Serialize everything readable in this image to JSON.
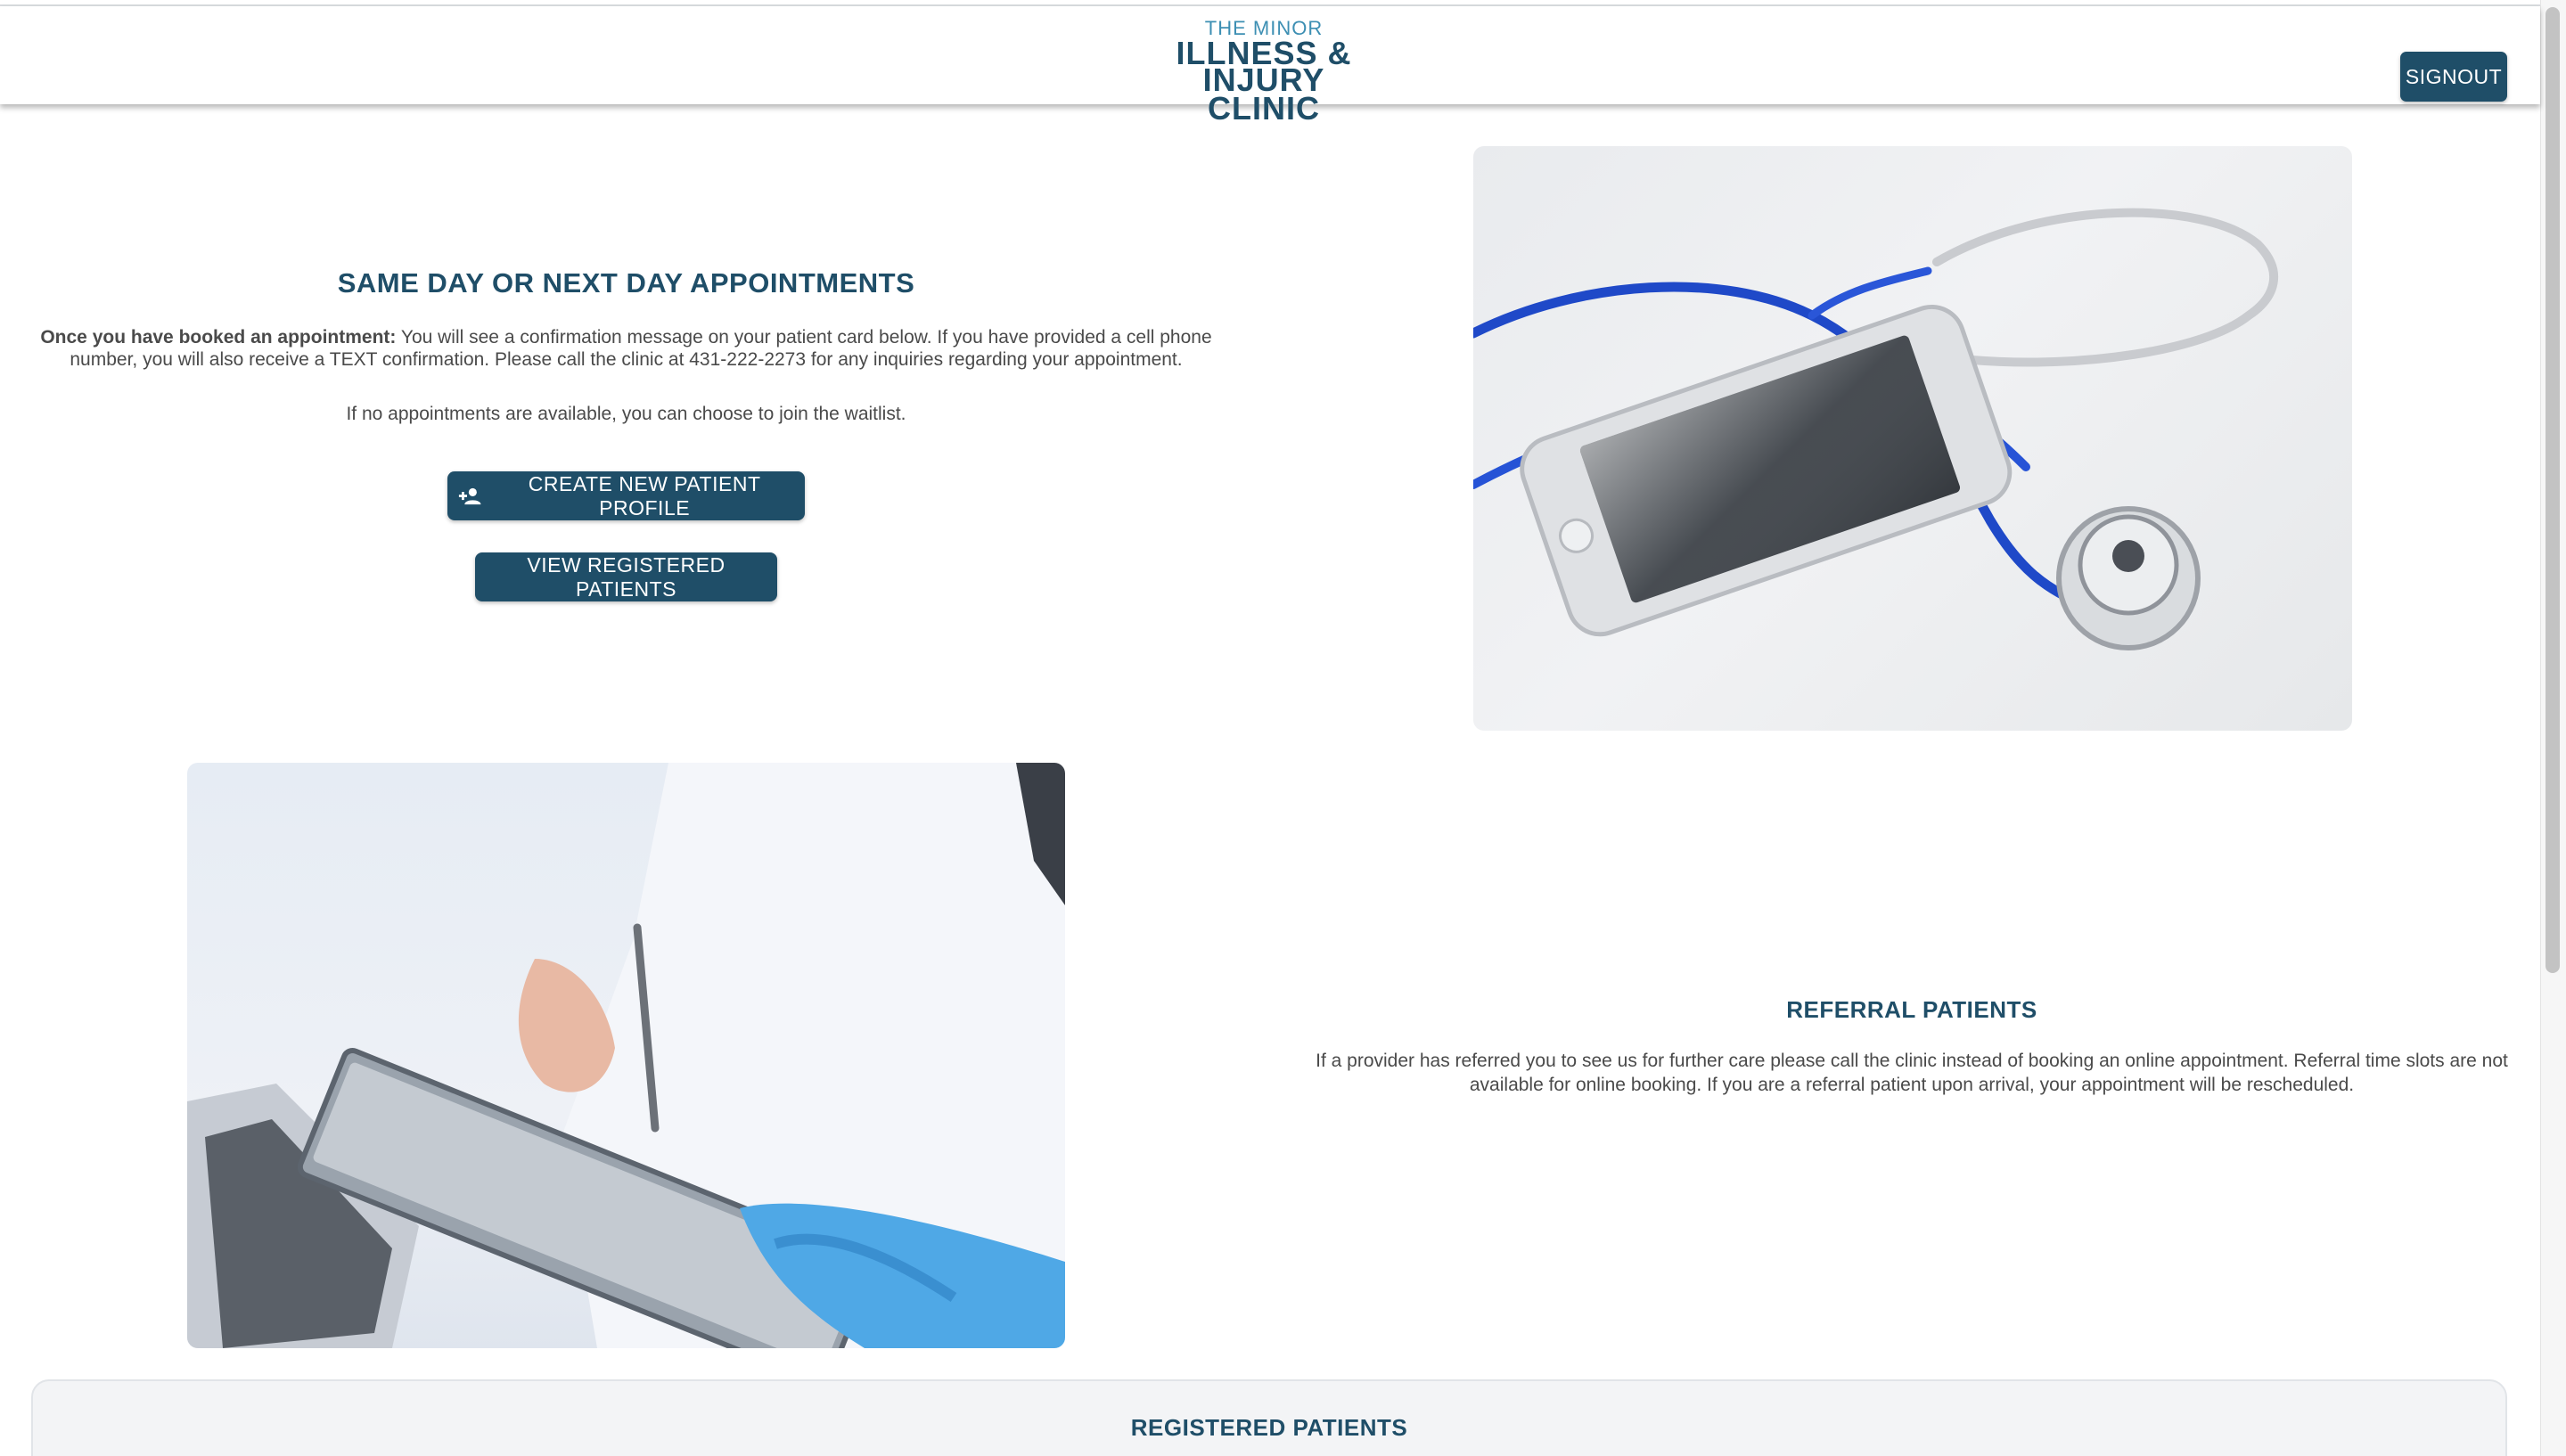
{
  "header": {
    "logo_top": "THE MINOR",
    "logo_line2": "ILLNESS & INJURY",
    "logo_line3": "CLINIC",
    "signout_label": "SIGNOUT"
  },
  "appointments": {
    "title": "SAME DAY OR NEXT DAY APPOINTMENTS",
    "intro_bold": "Once you have booked an appointment:",
    "intro_text": " You will see a confirmation message on your patient card below. If you have provided a cell phone number, you will also receive a TEXT confirmation. Please call the clinic at 431-222-2273 for any inquiries regarding your appointment.",
    "waitlist_text": "If no appointments are available, you can choose to join the waitlist.",
    "create_button_label": "CREATE NEW PATIENT PROFILE",
    "create_button_icon": "person-add-icon",
    "view_button_label": "VIEW REGISTERED PATIENTS"
  },
  "referral": {
    "title": "REFERRAL PATIENTS",
    "text": "If a provider has referred you to see us for further care please call the clinic instead of booking an online appointment. Referral time slots are not available for online booking. If you are a referral patient upon arrival, your appointment will be rescheduled."
  },
  "registered": {
    "title": "REGISTERED PATIENTS"
  },
  "colors": {
    "brand_dark": "#1f4e68",
    "brand_light": "#3d8fb3",
    "text": "#4a4a4a"
  }
}
